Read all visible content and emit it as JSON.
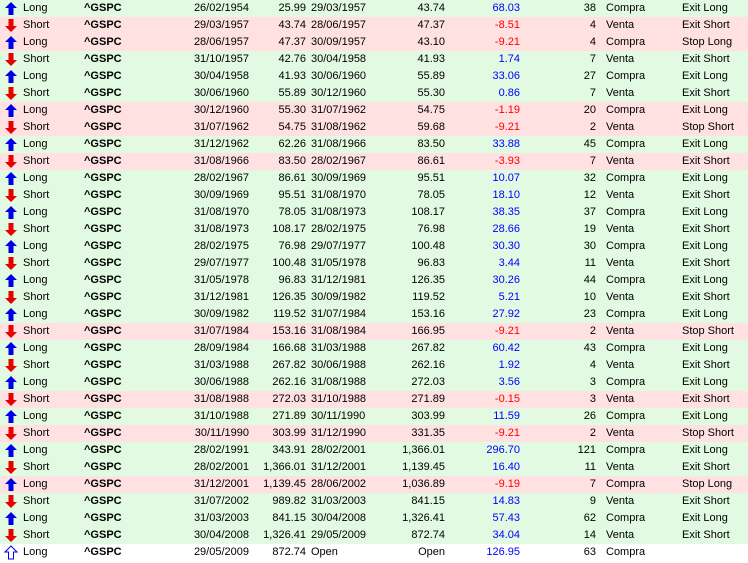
{
  "colors": {
    "win_row": "#e1fae1",
    "loss_row": "#ffe1e1",
    "positive": "#0000ff",
    "negative": "#ff0000",
    "long_arrow": "#0000e6",
    "short_arrow": "#e60000"
  },
  "trades": [
    {
      "side": "Long",
      "symbol": "^GSPC",
      "entry_date": "26/02/1954",
      "entry_price": "25.99",
      "exit_date": "29/03/1957",
      "exit_price": "43.74",
      "pct": "68.03",
      "bars": "38",
      "action": "Compra",
      "exit_type": "Exit Long",
      "result": "win",
      "icon": "long-arrow-icon"
    },
    {
      "side": "Short",
      "symbol": "^GSPC",
      "entry_date": "29/03/1957",
      "entry_price": "43.74",
      "exit_date": "28/06/1957",
      "exit_price": "47.37",
      "pct": "-8.51",
      "bars": "4",
      "action": "Venta",
      "exit_type": "Exit Short",
      "result": "loss",
      "icon": "short-arrow-icon"
    },
    {
      "side": "Long",
      "symbol": "^GSPC",
      "entry_date": "28/06/1957",
      "entry_price": "47.37",
      "exit_date": "30/09/1957",
      "exit_price": "43.10",
      "pct": "-9.21",
      "bars": "4",
      "action": "Compra",
      "exit_type": "Stop Long",
      "result": "loss",
      "icon": "long-arrow-icon"
    },
    {
      "side": "Short",
      "symbol": "^GSPC",
      "entry_date": "31/10/1957",
      "entry_price": "42.76",
      "exit_date": "30/04/1958",
      "exit_price": "41.93",
      "pct": "1.74",
      "bars": "7",
      "action": "Venta",
      "exit_type": "Exit Short",
      "result": "win",
      "icon": "short-arrow-icon"
    },
    {
      "side": "Long",
      "symbol": "^GSPC",
      "entry_date": "30/04/1958",
      "entry_price": "41.93",
      "exit_date": "30/06/1960",
      "exit_price": "55.89",
      "pct": "33.06",
      "bars": "27",
      "action": "Compra",
      "exit_type": "Exit Long",
      "result": "win",
      "icon": "long-arrow-icon"
    },
    {
      "side": "Short",
      "symbol": "^GSPC",
      "entry_date": "30/06/1960",
      "entry_price": "55.89",
      "exit_date": "30/12/1960",
      "exit_price": "55.30",
      "pct": "0.86",
      "bars": "7",
      "action": "Venta",
      "exit_type": "Exit Short",
      "result": "win",
      "icon": "short-arrow-icon"
    },
    {
      "side": "Long",
      "symbol": "^GSPC",
      "entry_date": "30/12/1960",
      "entry_price": "55.30",
      "exit_date": "31/07/1962",
      "exit_price": "54.75",
      "pct": "-1.19",
      "bars": "20",
      "action": "Compra",
      "exit_type": "Exit Long",
      "result": "loss",
      "icon": "long-arrow-icon"
    },
    {
      "side": "Short",
      "symbol": "^GSPC",
      "entry_date": "31/07/1962",
      "entry_price": "54.75",
      "exit_date": "31/08/1962",
      "exit_price": "59.68",
      "pct": "-9.21",
      "bars": "2",
      "action": "Venta",
      "exit_type": "Stop Short",
      "result": "loss",
      "icon": "short-arrow-icon"
    },
    {
      "side": "Long",
      "symbol": "^GSPC",
      "entry_date": "31/12/1962",
      "entry_price": "62.26",
      "exit_date": "31/08/1966",
      "exit_price": "83.50",
      "pct": "33.88",
      "bars": "45",
      "action": "Compra",
      "exit_type": "Exit Long",
      "result": "win",
      "icon": "long-arrow-icon"
    },
    {
      "side": "Short",
      "symbol": "^GSPC",
      "entry_date": "31/08/1966",
      "entry_price": "83.50",
      "exit_date": "28/02/1967",
      "exit_price": "86.61",
      "pct": "-3.93",
      "bars": "7",
      "action": "Venta",
      "exit_type": "Exit Short",
      "result": "loss",
      "icon": "short-arrow-icon"
    },
    {
      "side": "Long",
      "symbol": "^GSPC",
      "entry_date": "28/02/1967",
      "entry_price": "86.61",
      "exit_date": "30/09/1969",
      "exit_price": "95.51",
      "pct": "10.07",
      "bars": "32",
      "action": "Compra",
      "exit_type": "Exit Long",
      "result": "win",
      "icon": "long-arrow-icon"
    },
    {
      "side": "Short",
      "symbol": "^GSPC",
      "entry_date": "30/09/1969",
      "entry_price": "95.51",
      "exit_date": "31/08/1970",
      "exit_price": "78.05",
      "pct": "18.10",
      "bars": "12",
      "action": "Venta",
      "exit_type": "Exit Short",
      "result": "win",
      "icon": "short-arrow-icon"
    },
    {
      "side": "Long",
      "symbol": "^GSPC",
      "entry_date": "31/08/1970",
      "entry_price": "78.05",
      "exit_date": "31/08/1973",
      "exit_price": "108.17",
      "pct": "38.35",
      "bars": "37",
      "action": "Compra",
      "exit_type": "Exit Long",
      "result": "win",
      "icon": "long-arrow-icon"
    },
    {
      "side": "Short",
      "symbol": "^GSPC",
      "entry_date": "31/08/1973",
      "entry_price": "108.17",
      "exit_date": "28/02/1975",
      "exit_price": "76.98",
      "pct": "28.66",
      "bars": "19",
      "action": "Venta",
      "exit_type": "Exit Short",
      "result": "win",
      "icon": "short-arrow-icon"
    },
    {
      "side": "Long",
      "symbol": "^GSPC",
      "entry_date": "28/02/1975",
      "entry_price": "76.98",
      "exit_date": "29/07/1977",
      "exit_price": "100.48",
      "pct": "30.30",
      "bars": "30",
      "action": "Compra",
      "exit_type": "Exit Long",
      "result": "win",
      "icon": "long-arrow-icon"
    },
    {
      "side": "Short",
      "symbol": "^GSPC",
      "entry_date": "29/07/1977",
      "entry_price": "100.48",
      "exit_date": "31/05/1978",
      "exit_price": "96.83",
      "pct": "3.44",
      "bars": "11",
      "action": "Venta",
      "exit_type": "Exit Short",
      "result": "win",
      "icon": "short-arrow-icon"
    },
    {
      "side": "Long",
      "symbol": "^GSPC",
      "entry_date": "31/05/1978",
      "entry_price": "96.83",
      "exit_date": "31/12/1981",
      "exit_price": "126.35",
      "pct": "30.26",
      "bars": "44",
      "action": "Compra",
      "exit_type": "Exit Long",
      "result": "win",
      "icon": "long-arrow-icon"
    },
    {
      "side": "Short",
      "symbol": "^GSPC",
      "entry_date": "31/12/1981",
      "entry_price": "126.35",
      "exit_date": "30/09/1982",
      "exit_price": "119.52",
      "pct": "5.21",
      "bars": "10",
      "action": "Venta",
      "exit_type": "Exit Short",
      "result": "win",
      "icon": "short-arrow-icon"
    },
    {
      "side": "Long",
      "symbol": "^GSPC",
      "entry_date": "30/09/1982",
      "entry_price": "119.52",
      "exit_date": "31/07/1984",
      "exit_price": "153.16",
      "pct": "27.92",
      "bars": "23",
      "action": "Compra",
      "exit_type": "Exit Long",
      "result": "win",
      "icon": "long-arrow-icon"
    },
    {
      "side": "Short",
      "symbol": "^GSPC",
      "entry_date": "31/07/1984",
      "entry_price": "153.16",
      "exit_date": "31/08/1984",
      "exit_price": "166.95",
      "pct": "-9.21",
      "bars": "2",
      "action": "Venta",
      "exit_type": "Stop Short",
      "result": "loss",
      "icon": "short-arrow-icon"
    },
    {
      "side": "Long",
      "symbol": "^GSPC",
      "entry_date": "28/09/1984",
      "entry_price": "166.68",
      "exit_date": "31/03/1988",
      "exit_price": "267.82",
      "pct": "60.42",
      "bars": "43",
      "action": "Compra",
      "exit_type": "Exit Long",
      "result": "win",
      "icon": "long-arrow-icon"
    },
    {
      "side": "Short",
      "symbol": "^GSPC",
      "entry_date": "31/03/1988",
      "entry_price": "267.82",
      "exit_date": "30/06/1988",
      "exit_price": "262.16",
      "pct": "1.92",
      "bars": "4",
      "action": "Venta",
      "exit_type": "Exit Short",
      "result": "win",
      "icon": "short-arrow-icon"
    },
    {
      "side": "Long",
      "symbol": "^GSPC",
      "entry_date": "30/06/1988",
      "entry_price": "262.16",
      "exit_date": "31/08/1988",
      "exit_price": "272.03",
      "pct": "3.56",
      "bars": "3",
      "action": "Compra",
      "exit_type": "Exit Long",
      "result": "win",
      "icon": "long-arrow-icon"
    },
    {
      "side": "Short",
      "symbol": "^GSPC",
      "entry_date": "31/08/1988",
      "entry_price": "272.03",
      "exit_date": "31/10/1988",
      "exit_price": "271.89",
      "pct": "-0.15",
      "bars": "3",
      "action": "Venta",
      "exit_type": "Exit Short",
      "result": "loss",
      "icon": "short-arrow-icon"
    },
    {
      "side": "Long",
      "symbol": "^GSPC",
      "entry_date": "31/10/1988",
      "entry_price": "271.89",
      "exit_date": "30/11/1990",
      "exit_price": "303.99",
      "pct": "11.59",
      "bars": "26",
      "action": "Compra",
      "exit_type": "Exit Long",
      "result": "win",
      "icon": "long-arrow-icon"
    },
    {
      "side": "Short",
      "symbol": "^GSPC",
      "entry_date": "30/11/1990",
      "entry_price": "303.99",
      "exit_date": "31/12/1990",
      "exit_price": "331.35",
      "pct": "-9.21",
      "bars": "2",
      "action": "Venta",
      "exit_type": "Stop Short",
      "result": "loss",
      "icon": "short-arrow-icon"
    },
    {
      "side": "Long",
      "symbol": "^GSPC",
      "entry_date": "28/02/1991",
      "entry_price": "343.91",
      "exit_date": "28/02/2001",
      "exit_price": "1,366.01",
      "pct": "296.70",
      "bars": "121",
      "action": "Compra",
      "exit_type": "Exit Long",
      "result": "win",
      "icon": "long-arrow-icon"
    },
    {
      "side": "Short",
      "symbol": "^GSPC",
      "entry_date": "28/02/2001",
      "entry_price": "1,366.01",
      "exit_date": "31/12/2001",
      "exit_price": "1,139.45",
      "pct": "16.40",
      "bars": "11",
      "action": "Venta",
      "exit_type": "Exit Short",
      "result": "win",
      "icon": "short-arrow-icon"
    },
    {
      "side": "Long",
      "symbol": "^GSPC",
      "entry_date": "31/12/2001",
      "entry_price": "1,139.45",
      "exit_date": "28/06/2002",
      "exit_price": "1,036.89",
      "pct": "-9.19",
      "bars": "7",
      "action": "Compra",
      "exit_type": "Stop Long",
      "result": "loss",
      "icon": "long-arrow-icon"
    },
    {
      "side": "Short",
      "symbol": "^GSPC",
      "entry_date": "31/07/2002",
      "entry_price": "989.82",
      "exit_date": "31/03/2003",
      "exit_price": "841.15",
      "pct": "14.83",
      "bars": "9",
      "action": "Venta",
      "exit_type": "Exit Short",
      "result": "win",
      "icon": "short-arrow-icon"
    },
    {
      "side": "Long",
      "symbol": "^GSPC",
      "entry_date": "31/03/2003",
      "entry_price": "841.15",
      "exit_date": "30/04/2008",
      "exit_price": "1,326.41",
      "pct": "57.43",
      "bars": "62",
      "action": "Compra",
      "exit_type": "Exit Long",
      "result": "win",
      "icon": "long-arrow-icon"
    },
    {
      "side": "Short",
      "symbol": "^GSPC",
      "entry_date": "30/04/2008",
      "entry_price": "1,326.41",
      "exit_date": "29/05/2009",
      "exit_price": "872.74",
      "pct": "34.04",
      "bars": "14",
      "action": "Venta",
      "exit_type": "Exit Short",
      "result": "win",
      "icon": "short-arrow-icon"
    },
    {
      "side": "Long",
      "symbol": "^GSPC",
      "entry_date": "29/05/2009",
      "entry_price": "872.74",
      "exit_date": "Open",
      "exit_price": "Open",
      "pct": "126.95",
      "bars": "63",
      "action": "Compra",
      "exit_type": "",
      "result": "open",
      "icon": "long-arrow-outline-icon"
    }
  ]
}
